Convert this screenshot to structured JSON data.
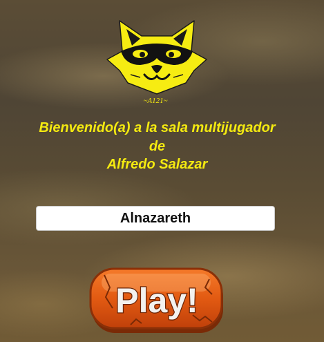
{
  "logo": {
    "signature": "~A121~"
  },
  "welcome": {
    "line1": "Bienvenido(a) a la sala multijugador",
    "line2": "de",
    "line3": "Alfredo Salazar"
  },
  "player_name": {
    "value": "Alnazareth"
  },
  "play_button": {
    "label": "Play!"
  },
  "colors": {
    "accent_yellow": "#f4ea10",
    "button_orange": "#e25a12"
  }
}
